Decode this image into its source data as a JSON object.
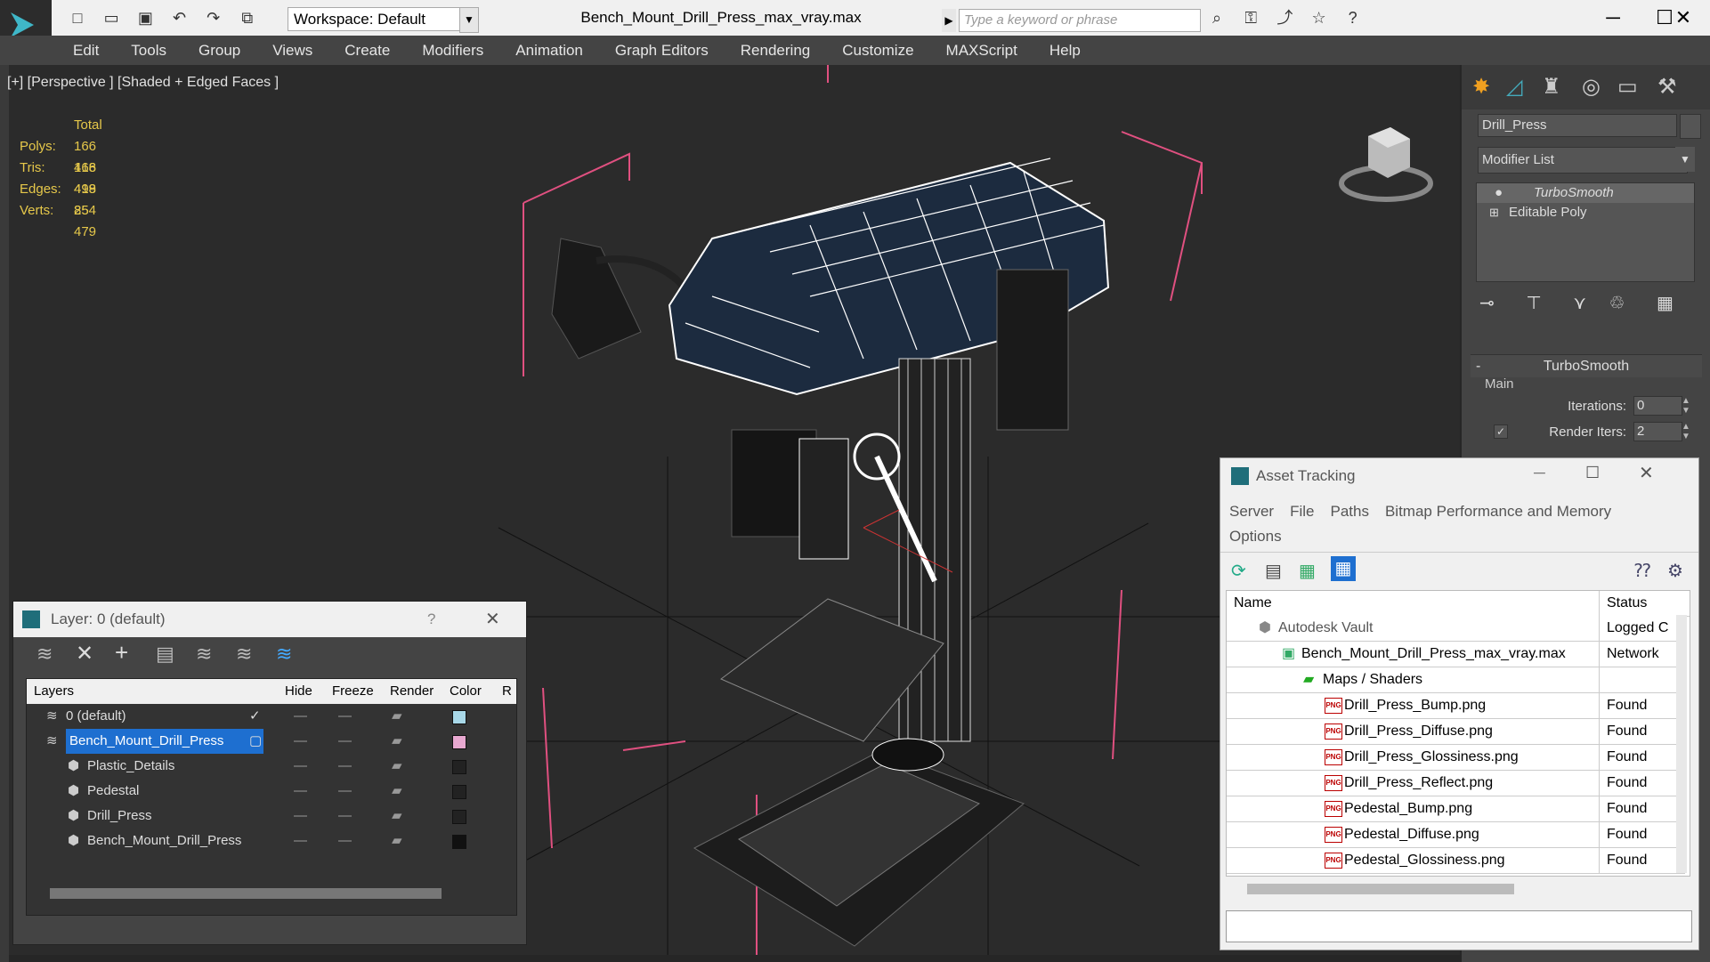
{
  "window": {
    "title": "Bench_Mount_Drill_Press_max_vray.max"
  },
  "toolbar": {
    "workspace_label": "Workspace: Default",
    "search_placeholder": "Type a keyword or phrase"
  },
  "menu": {
    "items": [
      "Edit",
      "Tools",
      "Group",
      "Views",
      "Create",
      "Modifiers",
      "Animation",
      "Graph Editors",
      "Rendering",
      "Customize",
      "MAXScript",
      "Help"
    ]
  },
  "viewport": {
    "label": "[+] [Perspective ] [Shaded + Edged Faces ]",
    "stats": {
      "header": "Total",
      "rows": [
        {
          "label": "Polys:",
          "value": "166 418"
        },
        {
          "label": "Tris:",
          "value": "166 418"
        },
        {
          "label": "Edges:",
          "value": "499 254"
        },
        {
          "label": "Verts:",
          "value": "85 479"
        }
      ]
    }
  },
  "command_panel": {
    "object_name": "Drill_Press",
    "modifier_list": "Modifier List",
    "stack": [
      "TurboSmooth",
      "Editable Poly"
    ],
    "rollout_title": "TurboSmooth",
    "group_main": "Main",
    "iterations_label": "Iterations:",
    "iterations_value": "0",
    "render_iters_label": "Render Iters:",
    "render_iters_value": "2"
  },
  "layer_window": {
    "title": "Layer: 0 (default)",
    "help": "?",
    "columns": [
      "Layers",
      "Hide",
      "Freeze",
      "Render",
      "Color",
      "R"
    ],
    "rows": [
      {
        "name": "0 (default)",
        "color": "#a8d8e8"
      },
      {
        "name": "Bench_Mount_Drill_Press",
        "color": "#e8a8d0"
      },
      {
        "name": "Plastic_Details",
        "color": "#222222"
      },
      {
        "name": "Pedestal",
        "color": "#222222"
      },
      {
        "name": "Drill_Press",
        "color": "#222222"
      },
      {
        "name": "Bench_Mount_Drill_Press",
        "color": "#111111"
      }
    ]
  },
  "asset_window": {
    "title": "Asset Tracking",
    "menu": [
      "Server",
      "File",
      "Paths",
      "Bitmap Performance and Memory",
      "Options"
    ],
    "columns": [
      "Name",
      "Status"
    ],
    "rows": [
      {
        "name": "Autodesk Vault",
        "status": "Logged C"
      },
      {
        "name": "Bench_Mount_Drill_Press_max_vray.max",
        "status": "Network"
      },
      {
        "name": "Maps / Shaders",
        "status": ""
      },
      {
        "name": "Drill_Press_Bump.png",
        "status": "Found"
      },
      {
        "name": "Drill_Press_Diffuse.png",
        "status": "Found"
      },
      {
        "name": "Drill_Press_Glossiness.png",
        "status": "Found"
      },
      {
        "name": "Drill_Press_Reflect.png",
        "status": "Found"
      },
      {
        "name": "Pedestal_Bump.png",
        "status": "Found"
      },
      {
        "name": "Pedestal_Diffuse.png",
        "status": "Found"
      },
      {
        "name": "Pedestal_Glossiness.png",
        "status": "Found"
      }
    ]
  },
  "colors": {
    "accent": "#1e6fd0",
    "stats_text": "#e6c84a",
    "bbox_pink": "#e05080"
  }
}
